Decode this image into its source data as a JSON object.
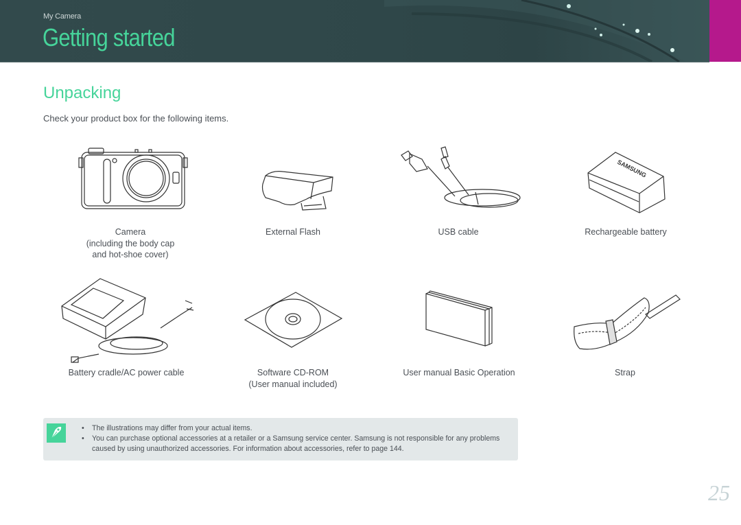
{
  "header": {
    "breadcrumb": "My Camera",
    "title": "Getting started",
    "accent_color": "#46d49a",
    "section_tab_color": "#b5198c"
  },
  "section": {
    "heading": "Unpacking",
    "intro": "Check your product box for the following items."
  },
  "items": [
    {
      "icon": "camera-icon",
      "lines": [
        "Camera",
        "(including the body cap",
        "and hot-shoe cover)"
      ]
    },
    {
      "icon": "external-flash-icon",
      "lines": [
        "External Flash"
      ]
    },
    {
      "icon": "usb-cable-icon",
      "lines": [
        "USB cable"
      ]
    },
    {
      "icon": "battery-icon",
      "lines": [
        "Rechargeable battery"
      ],
      "brand_text": "SAMSUNG"
    },
    {
      "icon": "battery-cradle-icon",
      "lines": [
        "Battery cradle/AC power cable"
      ]
    },
    {
      "icon": "cd-rom-icon",
      "lines": [
        "Software CD-ROM",
        "(User manual included)"
      ]
    },
    {
      "icon": "user-manual-icon",
      "lines": [
        "User manual Basic Operation"
      ]
    },
    {
      "icon": "strap-icon",
      "lines": [
        "Strap"
      ]
    }
  ],
  "note": {
    "icon": "note-pen-icon",
    "bullet": "•",
    "items": [
      "The illustrations may differ from your actual items.",
      "You can purchase optional accessories at a retailer or a Samsung service center. Samsung is not responsible for any problems caused by using unauthorized accessories. For information about accessories, refer to page 144."
    ]
  },
  "page_number": "25"
}
